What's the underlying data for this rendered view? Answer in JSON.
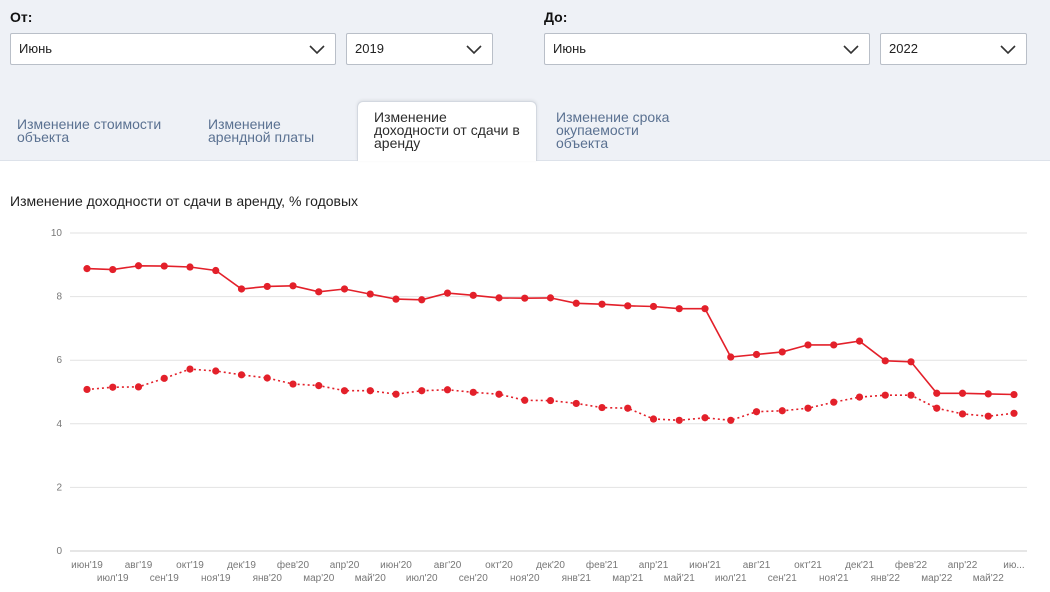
{
  "filters": {
    "from_label": "От:",
    "to_label": "До:",
    "from_month": "Июнь",
    "from_year": "2019",
    "to_month": "Июнь",
    "to_year": "2022"
  },
  "tabs": [
    {
      "label": "Изменение стоимости объекта",
      "active": false
    },
    {
      "label": "Изменение арендной платы",
      "active": false
    },
    {
      "label": "Изменение доходности от сдачи в аренду",
      "active": true
    },
    {
      "label": "Изменение срока окупаемости объекта",
      "active": false
    }
  ],
  "colors": {
    "series": "#e3202a",
    "accent": "#5a7191",
    "panel": "#eef1f6"
  },
  "chart_data": {
    "type": "line",
    "title": "Изменение доходности от сдачи в аренду, % годовых",
    "ylim": [
      0,
      10
    ],
    "yticks": [
      0,
      2,
      4,
      6,
      8,
      10
    ],
    "grid": true,
    "x": [
      "июн'19",
      "июл'19",
      "авг'19",
      "сен'19",
      "окт'19",
      "ноя'19",
      "дек'19",
      "янв'20",
      "фев'20",
      "мар'20",
      "апр'20",
      "май'20",
      "июн'20",
      "июл'20",
      "авг'20",
      "сен'20",
      "окт'20",
      "ноя'20",
      "дек'20",
      "янв'21",
      "фев'21",
      "мар'21",
      "апр'21",
      "май'21",
      "июн'21",
      "июл'21",
      "авг'21",
      "сен'21",
      "окт'21",
      "ноя'21",
      "дек'21",
      "янв'22",
      "фев'22",
      "мар'22",
      "апр'22",
      "май'22",
      "ию..."
    ],
    "series": [
      {
        "style": "solid",
        "values": [
          8.88,
          8.85,
          8.97,
          8.96,
          8.93,
          8.82,
          8.24,
          8.32,
          8.34,
          8.15,
          8.24,
          8.08,
          7.92,
          7.9,
          8.11,
          8.04,
          7.96,
          7.95,
          7.96,
          7.79,
          7.76,
          7.71,
          7.69,
          7.62,
          7.62,
          6.1,
          6.18,
          6.26,
          6.48,
          6.48,
          6.6,
          5.98,
          5.95,
          4.96,
          4.96,
          4.94,
          4.92
        ]
      },
      {
        "style": "dotted",
        "values": [
          5.08,
          5.15,
          5.16,
          5.43,
          5.72,
          5.66,
          5.54,
          5.44,
          5.25,
          5.2,
          5.04,
          5.04,
          4.93,
          5.04,
          5.07,
          4.99,
          4.93,
          4.74,
          4.73,
          4.64,
          4.51,
          4.49,
          4.15,
          4.11,
          4.19,
          4.11,
          4.38,
          4.41,
          4.49,
          4.68,
          4.84,
          4.9,
          4.9,
          4.49,
          4.31,
          4.24,
          4.33
        ]
      }
    ]
  }
}
